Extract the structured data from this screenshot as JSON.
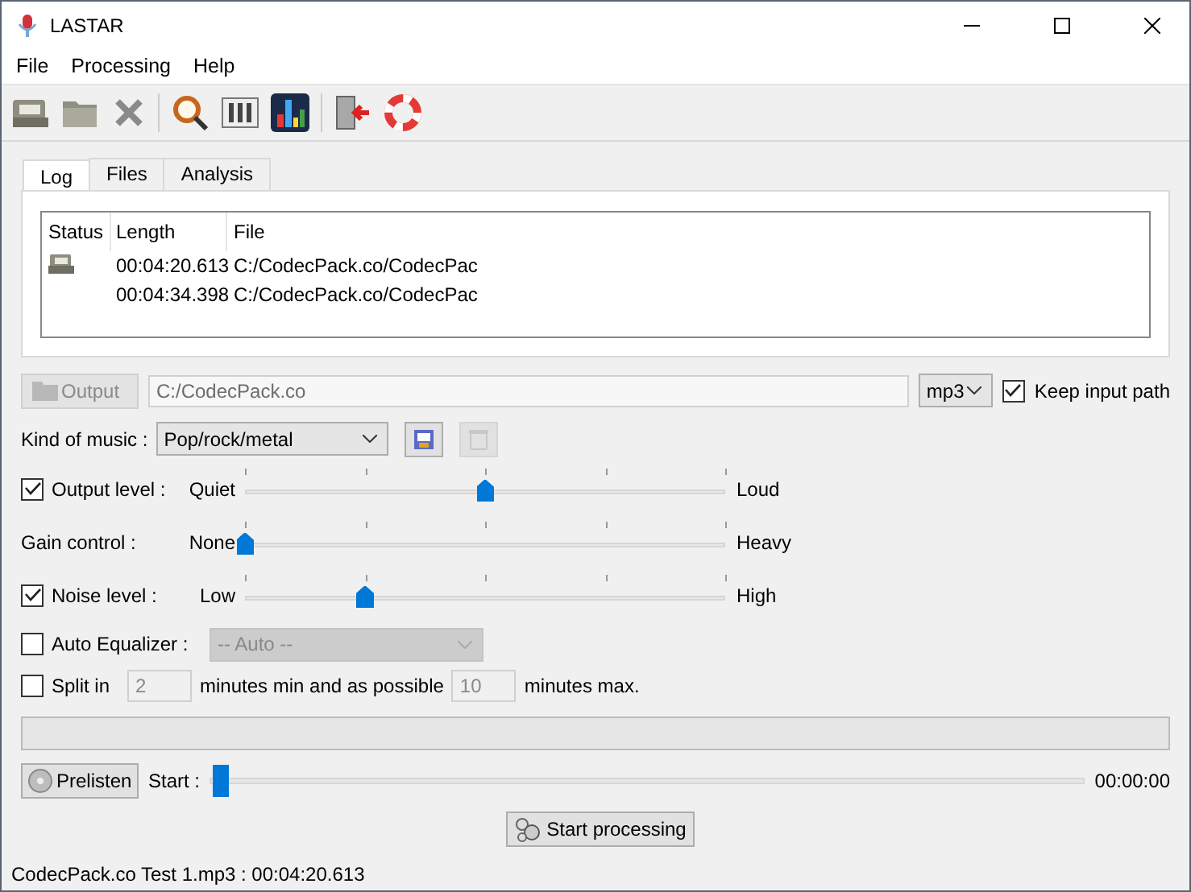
{
  "window": {
    "title": "LASTAR"
  },
  "menu": [
    "File",
    "Processing",
    "Help"
  ],
  "tabs": [
    {
      "label": "Log",
      "selected": true
    },
    {
      "label": "Files",
      "selected": false
    },
    {
      "label": "Analysis",
      "selected": false
    }
  ],
  "log": {
    "columns": [
      "Status",
      "Length",
      "File"
    ],
    "rows": [
      {
        "status_icon": true,
        "length": "00:04:20.613",
        "file": "C:/CodecPack.co/CodecPac"
      },
      {
        "status_icon": false,
        "length": "00:04:34.398",
        "file": "C:/CodecPack.co/CodecPac"
      }
    ]
  },
  "output": {
    "button": "Output",
    "disabled": true,
    "path": "C:/CodecPack.co",
    "format": "mp3",
    "keep_label": "Keep input path",
    "keep_checked": true
  },
  "kind_of_music": {
    "label": "Kind of music :",
    "value": "Pop/rock/metal",
    "delete_disabled": true
  },
  "sliders": [
    {
      "kind": "checkbox",
      "label": "Output level :",
      "checked": true,
      "min_label": "Quiet",
      "max_label": "Loud",
      "level": 0.5
    },
    {
      "kind": "plain",
      "label": "Gain control :",
      "min_label": "None",
      "max_label": "Heavy",
      "level": 0
    },
    {
      "kind": "checkbox",
      "label": "Noise level :",
      "checked": true,
      "min_label": "Low",
      "max_label": "High",
      "level": 0.25
    }
  ],
  "auto_equalizer": {
    "label": "Auto Equalizer :",
    "checked": false,
    "value": "-- Auto --"
  },
  "split": {
    "label": "Split in",
    "checked": false,
    "min": "2",
    "middle": "minutes min and as possible",
    "max": "10",
    "end": "minutes max."
  },
  "progress": {
    "level": 0
  },
  "prelisten": {
    "button": "Prelisten",
    "label": "Start :",
    "level": 0,
    "time": "00:00:00"
  },
  "start_button": "Start processing",
  "status_bar": "CodecPack.co Test 1.mp3 : 00:04:20.613"
}
